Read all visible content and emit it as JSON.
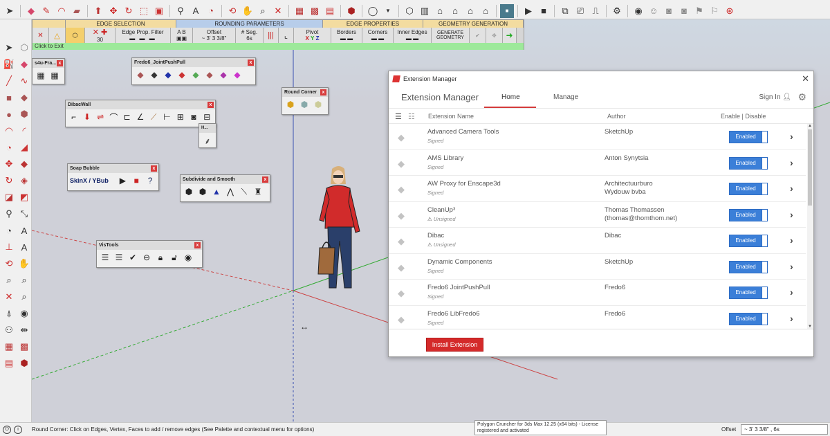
{
  "toolbar": {
    "icons": [
      "select-icon",
      "eraser-icon",
      "pencil-icon",
      "arc-icon",
      "paint-icon",
      "push-pull-icon",
      "move-icon",
      "rotate-icon",
      "scale-icon",
      "tape-icon",
      "text-icon",
      "orbit-icon",
      "pan-icon",
      "zoom-icon",
      "zoom-extents-icon",
      "component-icon",
      "warehouse-icon",
      "extension-icon",
      "user-icon",
      "iso-icon",
      "top-view-icon",
      "front-view-icon",
      "right-view-icon",
      "back-view-icon",
      "left-view-icon",
      "model-info-icon",
      "play-icon",
      "stop-icon",
      "section-icon",
      "camera-icon",
      "settings-icon"
    ]
  },
  "round_corner": {
    "sections": [
      "EDGE SELECTION",
      "ROUNDING PARAMETERS",
      "EDGE PROPERTIES",
      "GEOMETRY GENERATION"
    ],
    "edge_prop_filter": "Edge Prop. Filter",
    "number_30": "30",
    "offset_label": "Offset",
    "offset_value": "~ 3' 3 3/8\"",
    "seg_label": "# Seg.",
    "seg_value": "6s",
    "pivot_label": "Pivot",
    "pivot_x": "X",
    "pivot_y": "Y",
    "pivot_z": "Z",
    "ab_label": "A B",
    "borders": "Borders",
    "corners": "Corners",
    "inner_edges": "Inner Edges",
    "generate": "GENERATE GEOMETRY",
    "status": "Click to Exit"
  },
  "palettes": {
    "s4u": "s4u-Fra...",
    "fredo6": "Fredo6_JointPushPull",
    "dibac": "DibacWall",
    "round_corner": "Round Corner",
    "soap": "Soap Bubble",
    "soap_text": "SkinX / YBub",
    "subdivide": "Subdivide and Smooth",
    "vistools": "VisTools",
    "small": "H..."
  },
  "extension_manager": {
    "window_title": "Extension Manager",
    "brand": "Extension Manager",
    "tab_home": "Home",
    "tab_manage": "Manage",
    "sign_in": "Sign In",
    "col_name": "Extension Name",
    "col_author": "Author",
    "col_enable": "Enable | Disable",
    "install_button": "Install Extension",
    "extensions": [
      {
        "name": "Advanced Camera Tools",
        "status": "Signed",
        "author": "SketchUp",
        "author2": "",
        "toggle": "Enabled"
      },
      {
        "name": "AMS Library",
        "status": "Signed",
        "author": "Anton Synytsia",
        "author2": "",
        "toggle": "Enabled"
      },
      {
        "name": "AW Proxy for Enscape3d",
        "status": "Signed",
        "author": "Architectuurburo",
        "author2": "Wydouw bvba",
        "toggle": "Enabled"
      },
      {
        "name": "CleanUp³",
        "status": "Unsigned",
        "author": "Thomas Thomassen",
        "author2": "(thomas@thomthom.net)",
        "toggle": "Enabled"
      },
      {
        "name": "Dibac",
        "status": "Unsigned",
        "author": "Dibac",
        "author2": "",
        "toggle": "Enabled"
      },
      {
        "name": "Dynamic Components",
        "status": "Signed",
        "author": "SketchUp",
        "author2": "",
        "toggle": "Enabled"
      },
      {
        "name": "Fredo6 JointPushPull",
        "status": "Signed",
        "author": "Fredo6",
        "author2": "",
        "toggle": "Enabled"
      },
      {
        "name": "Fredo6 LibFredo6",
        "status": "Signed",
        "author": "Fredo6",
        "author2": "",
        "toggle": "Enabled"
      }
    ]
  },
  "statusbar": {
    "message": "Round Corner: Click on Edges, Vertex, Faces to add / remove edges (See Palette and contextual menu for options)",
    "tooltip_line1": "Polygon Cruncher for 3ds Max 12.25 (x64 bits) - License",
    "tooltip_line2": "registered and activated",
    "offset_label": "Offset",
    "offset_value": "~ 3' 3 3/8\" , 6s"
  },
  "colors": {
    "accent_red": "#d42a2a",
    "toggle_blue": "#3b7fd8",
    "status_green": "#9de99a",
    "section_orange": "#f3dca0",
    "section_blue": "#b7cdea"
  }
}
